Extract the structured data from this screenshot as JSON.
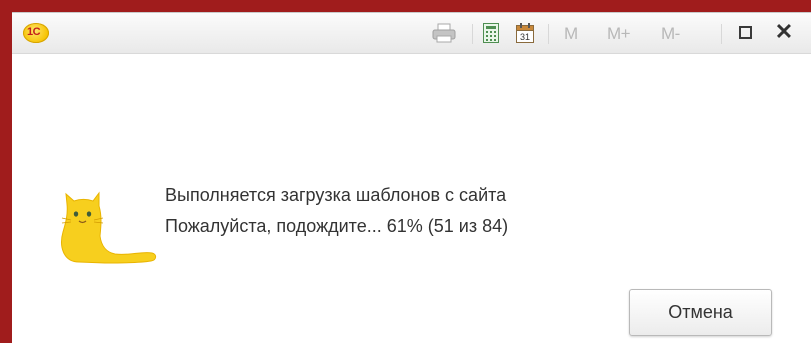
{
  "titlebar": {
    "logo_text": "1С",
    "icons": [
      "printer-icon",
      "calculator-icon",
      "calendar-icon"
    ],
    "calendar_day": "31",
    "memory_buttons": [
      "M",
      "M+",
      "M-"
    ],
    "close_glyph": "✕"
  },
  "message": {
    "line1": "Выполняется загрузка шаблонов с сайта",
    "line2": "Пожалуйста, подождите... 61% (51 из 84)",
    "progress_percent": 61,
    "progress_done": 51,
    "progress_total": 84
  },
  "buttons": {
    "cancel_label": "Отмена"
  },
  "colors": {
    "frame": "#a01c1c",
    "logo": "#f6c200",
    "cat": "#f7cf1e"
  }
}
